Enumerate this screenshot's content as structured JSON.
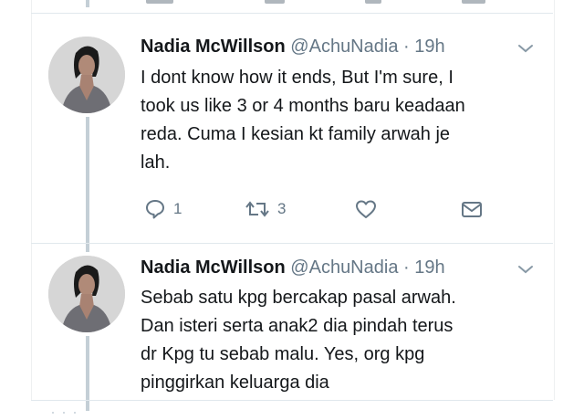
{
  "thread": {
    "tweets": [
      {
        "name": "Nadia McWillson",
        "handle": "@AchuNadia",
        "separator": "·",
        "time": "19h",
        "text_lines": [
          "I dont know how it ends, But I'm sure, I",
          "took us like 3 or 4 months baru keadaan",
          "reda. Cuma I kesian kt family arwah je",
          "lah."
        ],
        "actions": {
          "reply_count": "1",
          "retweet_count": "3",
          "like_icon": "heart-icon",
          "dm_icon": "envelope-icon"
        }
      },
      {
        "name": "Nadia McWillson",
        "handle": "@AchuNadia",
        "separator": "·",
        "time": "19h",
        "text_lines": [
          "Sebab satu kpg bercakap pasal arwah.",
          "Dan isteri serta anak2 dia pindah terus",
          "dr Kpg tu sebab malu. Yes, org kpg",
          "pinggirkan keluarga dia"
        ]
      }
    ]
  },
  "colors": {
    "text": "#14171a",
    "secondary": "#657786",
    "thread_line": "#c4cfd6",
    "divider": "#e1e8ed"
  }
}
